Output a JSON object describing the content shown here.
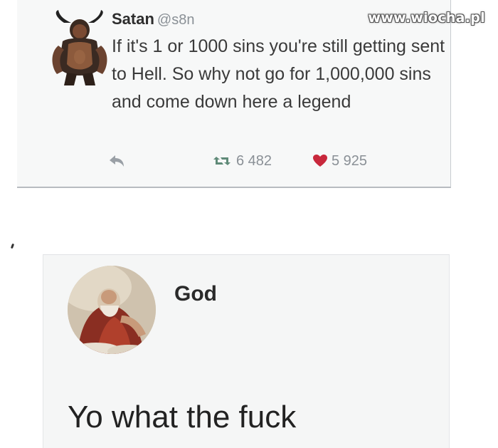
{
  "watermark": "www.wiocha.pl",
  "satan_tweet": {
    "name": "Satan",
    "handle": "@s8n",
    "text": "If it's 1 or 1000 sins you're still getting sent to Hell. So why not go for 1,000,000 sins and come down here a legend",
    "retweet_count": "6 482",
    "like_count": "5 925",
    "colors": {
      "retweet_icon": "#5f8a78",
      "like_icon": "#c8283c",
      "handle": "#8a9096"
    }
  },
  "god_post": {
    "name": "God",
    "text": "Yo what the fuck"
  }
}
